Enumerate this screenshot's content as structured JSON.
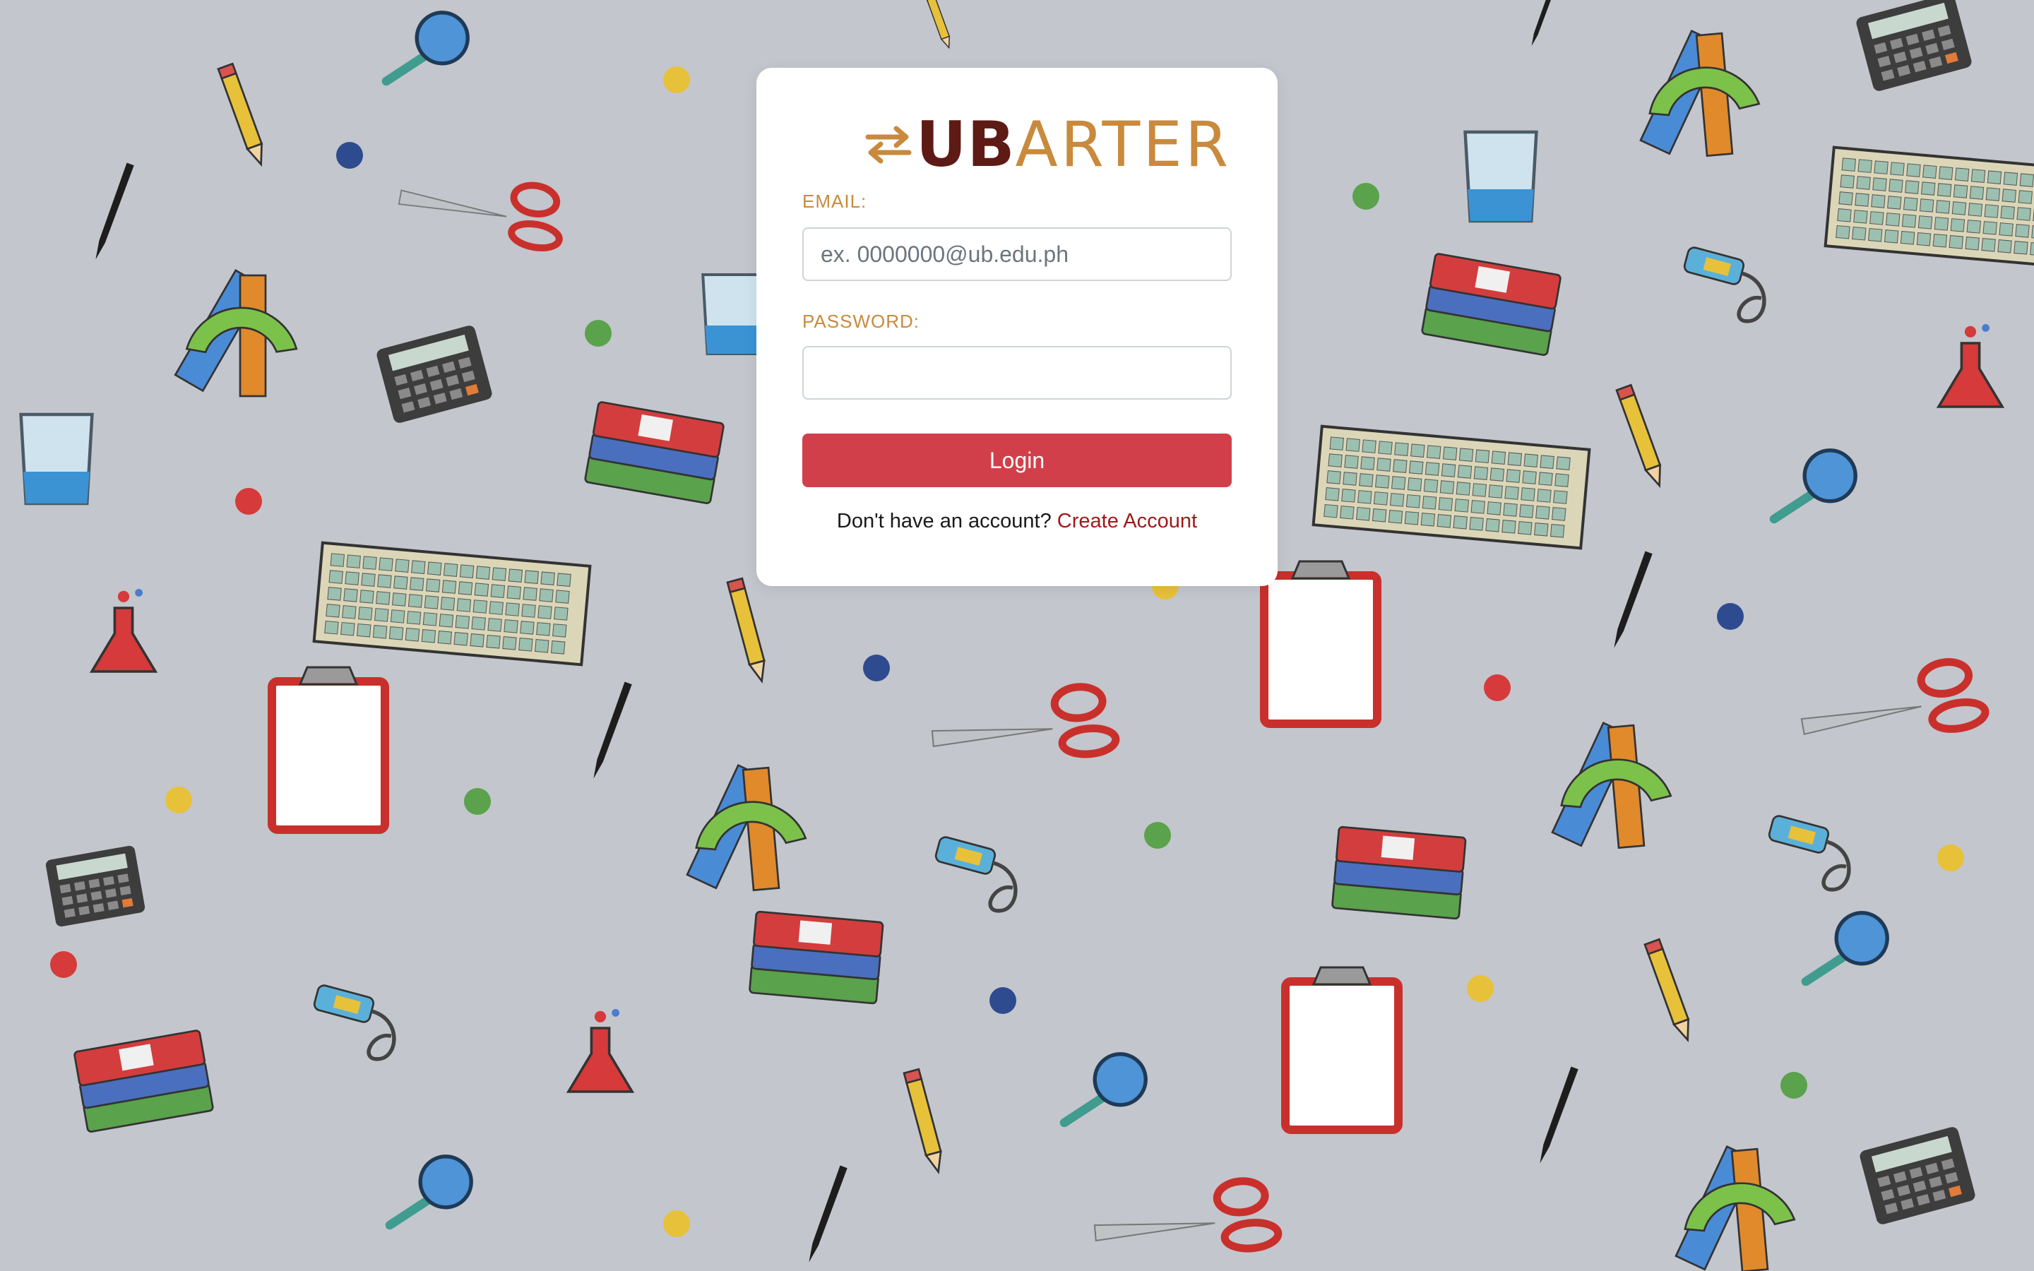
{
  "brand": {
    "name_bold": "UB",
    "name_light": "ARTER",
    "logo_icon": "swap-arrows-icon",
    "colors": {
      "dark": "#5e1a14",
      "accent": "#c98a3d"
    }
  },
  "form": {
    "email_label": "EMAIL:",
    "email_placeholder": "ex. 0000000@ub.edu.ph",
    "email_value": "",
    "password_label": "PASSWORD:",
    "password_value": "",
    "login_label": "Login",
    "login_color": "#d1404a"
  },
  "footer": {
    "prompt": "Don't have an account? ",
    "link_label": "Create Account"
  },
  "background": {
    "color": "#c3c6cc",
    "pattern_icons": [
      "pencil-icon",
      "pen-icon",
      "magnifier-icon",
      "scissors-icon",
      "calculator-icon",
      "keyboard-icon",
      "books-icon",
      "beaker-icon",
      "flask-icon",
      "clipboard-icon",
      "usb-drive-icon",
      "ruler-protractor-icon",
      "dot"
    ]
  }
}
